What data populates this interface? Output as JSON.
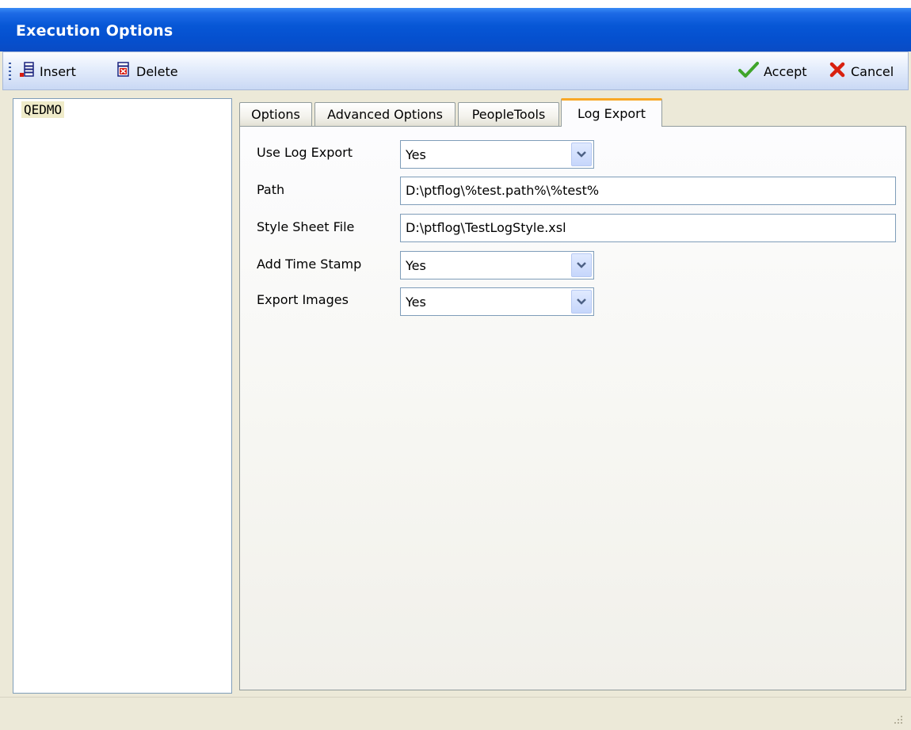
{
  "window": {
    "title": "Execution Options"
  },
  "toolbar": {
    "insert_label": "Insert",
    "delete_label": "Delete",
    "accept_label": "Accept",
    "cancel_label": "Cancel"
  },
  "tree": {
    "items": [
      "QEDMO"
    ]
  },
  "tabs": [
    {
      "label": "Options",
      "active": false
    },
    {
      "label": "Advanced Options",
      "active": false
    },
    {
      "label": "PeopleTools",
      "active": false
    },
    {
      "label": "Log Export",
      "active": true
    }
  ],
  "form": {
    "use_log_export": {
      "label": "Use Log Export",
      "value": "Yes"
    },
    "path": {
      "label": "Path",
      "value": "D:\\ptflog\\%test.path%\\%test%"
    },
    "style_sheet_file": {
      "label": "Style Sheet File",
      "value": "D:\\ptflog\\TestLogStyle.xsl"
    },
    "add_time_stamp": {
      "label": "Add Time Stamp",
      "value": "Yes"
    },
    "export_images": {
      "label": "Export Images",
      "value": "Yes"
    }
  },
  "icons": {
    "insert": "insert-row-icon",
    "delete": "delete-row-icon",
    "accept": "checkmark-icon",
    "cancel": "x-icon",
    "dropdown": "chevron-down-icon",
    "grip": "resize-grip-icon"
  },
  "colors": {
    "title_bar": "#0757d6",
    "active_tab_accent": "#f9a827",
    "accept_green": "#3fa52b",
    "cancel_red": "#d8200f"
  }
}
